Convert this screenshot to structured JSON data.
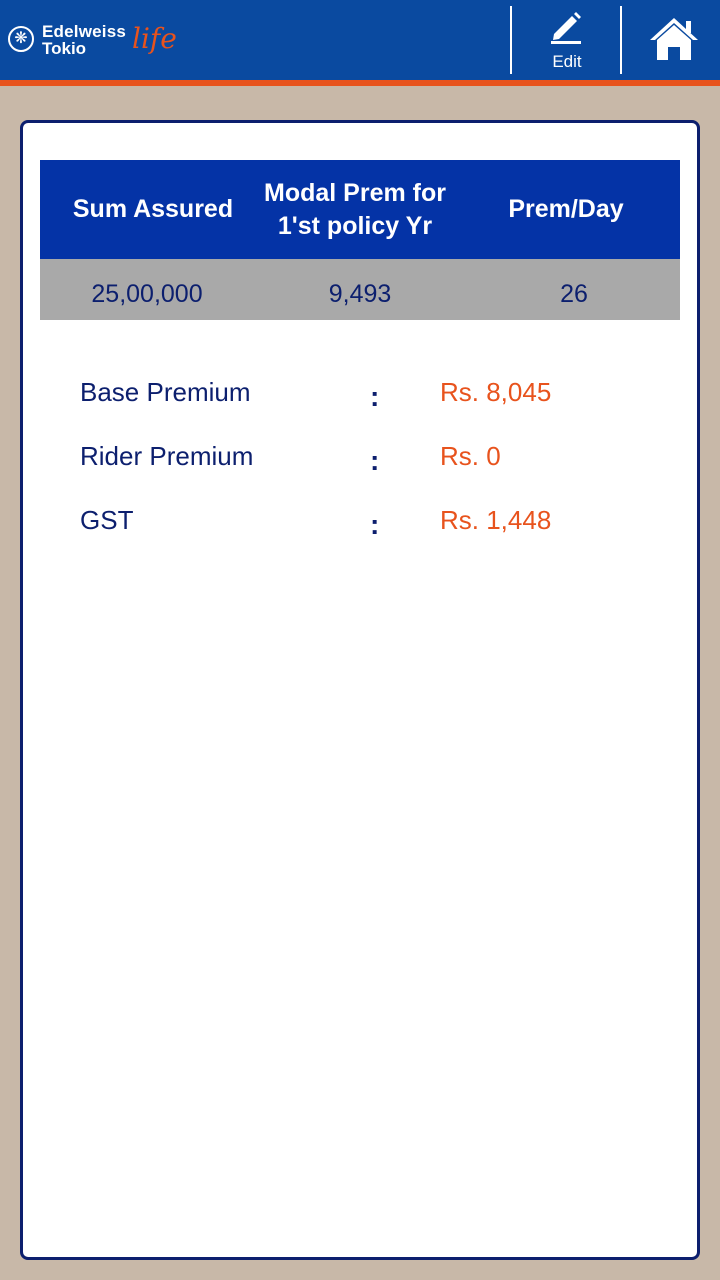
{
  "header": {
    "logo_line1": "Edelweiss",
    "logo_line2": "Tokio",
    "logo_script": "life",
    "edit_label": "Edit",
    "brand_color": "#0a4aa0",
    "accent_color": "#e8531d"
  },
  "summary_table": {
    "headers": [
      "Sum Assured",
      "Modal Prem for 1'st policy Yr",
      "Prem/Day"
    ],
    "values": [
      "25,00,000",
      "9,493",
      "26"
    ]
  },
  "premium_details": [
    {
      "label": "Base Premium",
      "separator": ":",
      "value": "Rs. 8,045"
    },
    {
      "label": "Rider Premium",
      "separator": ":",
      "value": "Rs. 0"
    },
    {
      "label": "GST",
      "separator": ":",
      "value": "Rs. 1,448"
    }
  ],
  "icons": {
    "logo": "edelweiss-tokio-logo",
    "edit": "pencil-icon",
    "home": "home-icon"
  }
}
